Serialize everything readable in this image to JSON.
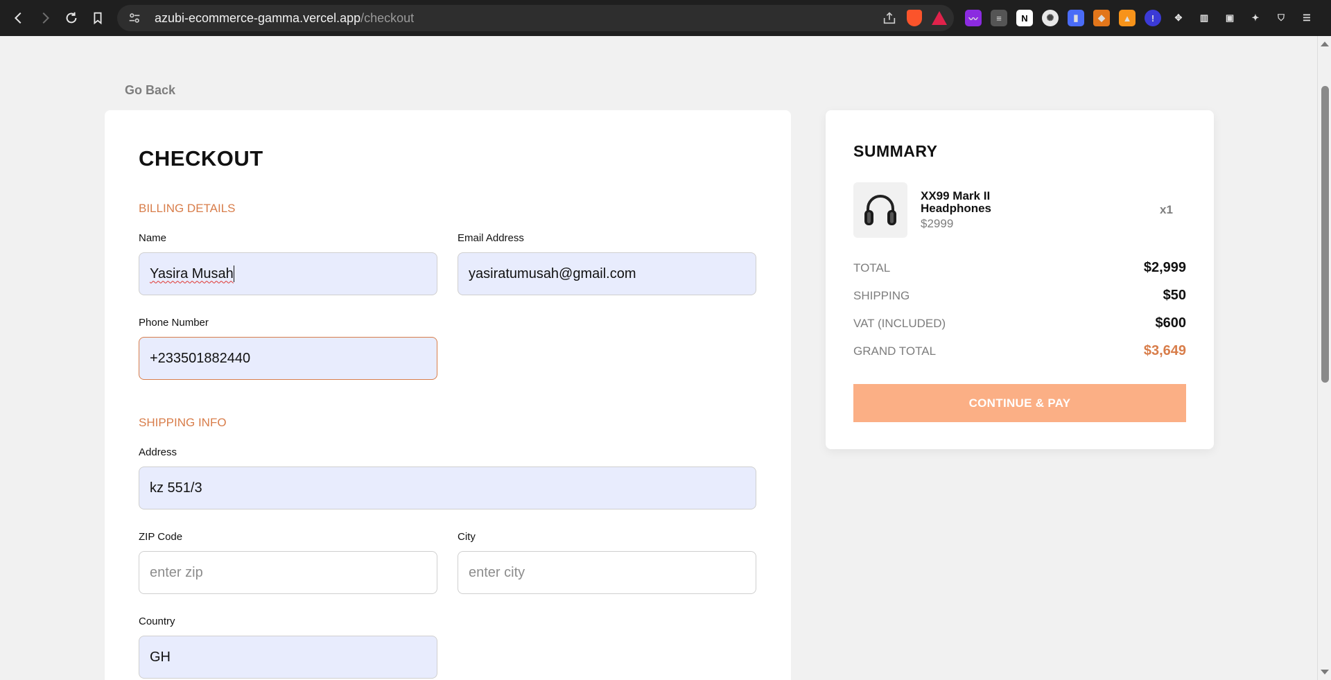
{
  "browser": {
    "url_host": "azubi-ecommerce-gamma.vercel.app",
    "url_path": "/checkout"
  },
  "page": {
    "go_back": "Go Back"
  },
  "checkout": {
    "title": "CHECKOUT",
    "billing": {
      "section_title": "BILLING DETAILS",
      "name_label": "Name",
      "name_value": "Yasira Musah",
      "email_label": "Email Address",
      "email_value": "yasiratumusah@gmail.com",
      "phone_label": "Phone Number",
      "phone_value": "+233501882440"
    },
    "shipping": {
      "section_title": "SHIPPING INFO",
      "address_label": "Address",
      "address_value": "kz 551/3",
      "zip_label": "ZIP Code",
      "zip_placeholder": "enter zip",
      "city_label": "City",
      "city_placeholder": "enter city",
      "country_label": "Country",
      "country_value": "GH"
    }
  },
  "summary": {
    "title": "SUMMARY",
    "item": {
      "name": "XX99 Mark II Headphones",
      "price": "$2999",
      "quantity": "x1"
    },
    "rows": [
      {
        "label": "TOTAL",
        "value": "$2,999"
      },
      {
        "label": "SHIPPING",
        "value": "$50"
      },
      {
        "label": "VAT (INCLUDED)",
        "value": "$600"
      },
      {
        "label": "GRAND TOTAL",
        "value": "$3,649"
      }
    ],
    "pay_button": "CONTINUE & PAY"
  },
  "colors": {
    "accent": "#d87d4a",
    "button": "#fbaf85",
    "filled_input": "#e8ecfd"
  }
}
